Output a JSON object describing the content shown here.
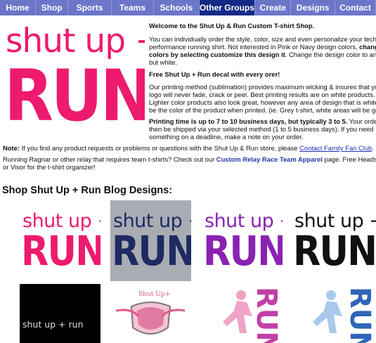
{
  "nav": {
    "items": [
      "Home",
      "Shop",
      "Sports",
      "Teams",
      "Schools",
      "Other Groups",
      "Create",
      "Designs",
      "Contact"
    ],
    "active": "Other Groups"
  },
  "hero": {
    "logo_top": "shut up +",
    "logo_bottom": "RUN"
  },
  "intro": {
    "title": "Welcome to the Shut Up & Run Custom T-shirt Shop.",
    "lines": [
      "You can individually order the style, color, size and even personalize your techn",
      "performance running shirt.  Not interested in Pink or Navy design colors, ",
      "colors by selecting customize this design it.  Change the design color to any",
      "but white."
    ],
    "bold1": "change",
    "bold2": "colors by selecting customize this design it"
  },
  "decal": "Free Shut Up + Run decal with every orer!",
  "printing": [
    "Our printing method (sublimation) provides maximum wicking & insures that you",
    "logo will never fade, crack or peel.  Best printing results are on white products.",
    " Lighter color products also look great, however any area of design that is white",
    "be the color of the product when printed.  (ie.  Grey t-shirt, white areas will be gra"
  ],
  "timing": {
    "bold": "Printing time is up to 7 to 10 business days, but typically 3 to 5.",
    "rest1": "  Your orde",
    "line2": "then be shipped via your selected method (1 to 5 business days).  If you need",
    "line3": "something on a deadline, make a note on your order."
  },
  "note": {
    "label": "Note:",
    "text": "  If you find any product requests or problems or questions with the Shut Up & Run store, please ",
    "link": "Contact Family Fan Club",
    "end": "."
  },
  "ragnar": {
    "text1": "Running Ragnar or other relay that requires team t-shirts?  Check out our ",
    "link": "Custom Relay Race Team Apparel",
    "text2": " page.  Free Headsweat H",
    "line2": "or Visor for the t-shirt organizer!"
  },
  "section_title": "Shop Shut Up + Run Blog Designs:",
  "designs": [
    {
      "top": "shut up +",
      "bottom": "RUN",
      "color": "#ee1a6d",
      "bg": "#ffffff"
    },
    {
      "top": "shut up +",
      "bottom": "RUN",
      "color": "#1f2a63",
      "bg": "#a9acb3"
    },
    {
      "top": "shut up +",
      "bottom": "RUN",
      "color": "#8a22b3",
      "bg": "#ffffff"
    },
    {
      "top": "shut up +",
      "bottom": "RUN",
      "color": "#111111",
      "bg": "#ffffff"
    }
  ],
  "designs_row2": [
    {
      "text": "shut up + run",
      "color": "#dddddd",
      "bg": "#000000"
    },
    {
      "text": "Shut Up+",
      "color": "#e05a8c",
      "bg": "#ffffff"
    },
    {
      "text": "RUN",
      "color": "#c33fa7",
      "bg": "#ffffff"
    },
    {
      "text": "RUN",
      "color": "#2f66b8",
      "bg": "#ffffff"
    }
  ],
  "colors": {
    "nav": "#6c76c9",
    "nav_active": "#142a86",
    "pink": "#ee1a6d"
  }
}
